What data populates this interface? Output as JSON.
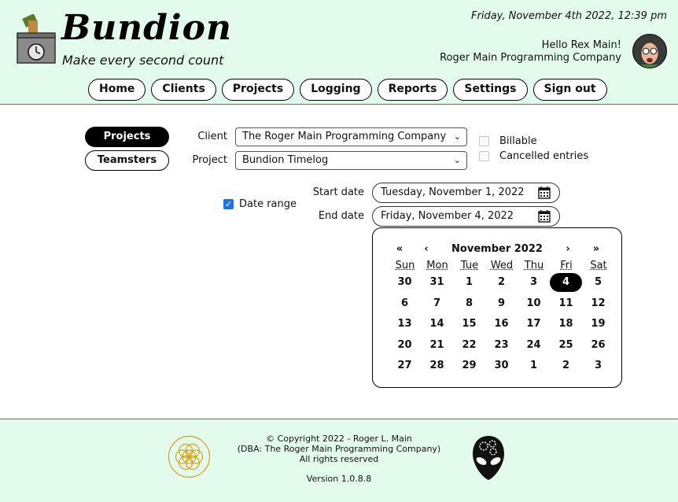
{
  "header": {
    "brand": "Bundion",
    "tagline": "Make every second count",
    "datetime": "Friday, November 4th 2022, 12:39 pm",
    "greeting": "Hello Rex Main!",
    "company": "Roger Main Programming Company"
  },
  "nav": [
    "Home",
    "Clients",
    "Projects",
    "Logging",
    "Reports",
    "Settings",
    "Sign out"
  ],
  "sidebar": {
    "active": "Projects",
    "other": "Teamsters"
  },
  "filters": {
    "client_label": "Client",
    "client_value": "The Roger Main Programming Company",
    "project_label": "Project",
    "project_value": "Bundion Timelog",
    "billable_label": "Billable",
    "cancelled_label": "Cancelled entries",
    "date_range_label": "Date range",
    "start_label": "Start date",
    "start_value": "Tuesday, November 1, 2022",
    "end_label": "End date",
    "end_value": "Friday, November 4, 2022"
  },
  "calendar": {
    "prev_year": "«",
    "prev_month": "‹",
    "title": "November 2022",
    "next_month": "›",
    "next_year": "»",
    "weekdays": [
      "Sun",
      "Mon",
      "Tue",
      "Wed",
      "Thu",
      "Fri",
      "Sat"
    ],
    "weeks": [
      [
        "30",
        "31",
        "1",
        "2",
        "3",
        "4",
        "5"
      ],
      [
        "6",
        "7",
        "8",
        "9",
        "10",
        "11",
        "12"
      ],
      [
        "13",
        "14",
        "15",
        "16",
        "17",
        "18",
        "19"
      ],
      [
        "20",
        "21",
        "22",
        "23",
        "24",
        "25",
        "26"
      ],
      [
        "27",
        "28",
        "29",
        "30",
        "1",
        "2",
        "3"
      ]
    ],
    "selected": "4"
  },
  "footer": {
    "copyright": "© Copyright 2022 - Roger L. Main",
    "dba": "(DBA: The Roger Main Programming Company)",
    "rights": "All rights reserved",
    "version": "Version 1.0.8.8"
  }
}
